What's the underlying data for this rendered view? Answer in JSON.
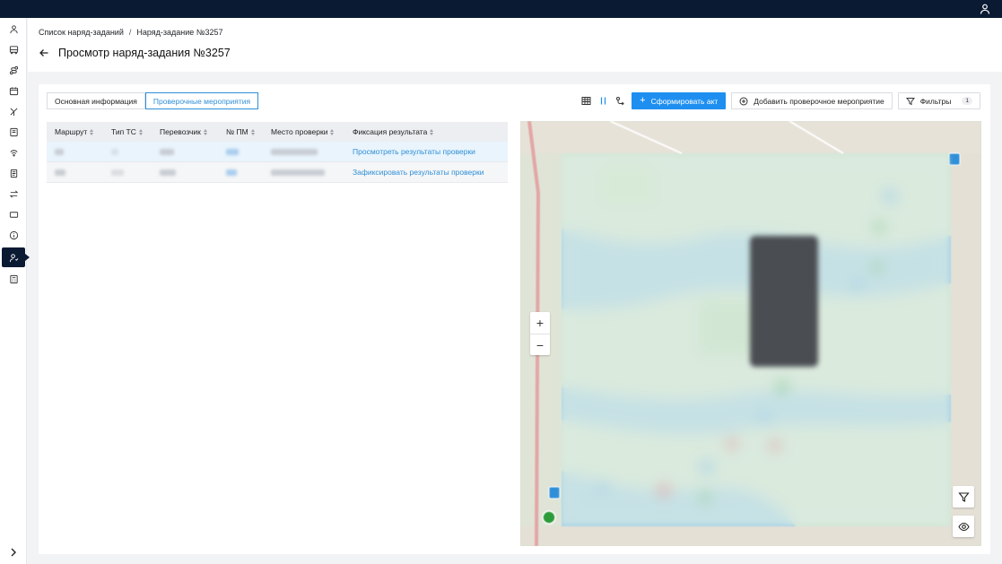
{
  "breadcrumbs": [
    "Список наряд-заданий",
    "Наряд-задание №3257"
  ],
  "breadcrumb_separator": "/",
  "page_title": "Просмотр наряд-задания №3257",
  "tabs": [
    {
      "label": "Основная информация",
      "active": false
    },
    {
      "label": "Проверочные мероприятия",
      "active": true
    }
  ],
  "toolbar": {
    "table_view_icon": "table-icon",
    "split_view_icon": "columns-icon",
    "map_view_icon": "map-route-icon",
    "primary_button": "Сформировать акт",
    "add_button": "Добавить проверочное мероприятие",
    "filters_button": "Фильтры",
    "filters_count": "1"
  },
  "table": {
    "columns": [
      "Маршрут",
      "Тип ТС",
      "Перевозчик",
      "№ ПМ",
      "Место проверки",
      "Фиксация результата"
    ],
    "rows": [
      {
        "result_action": "Просмотреть результаты проверки",
        "selected": true
      },
      {
        "result_action": "Зафиксировать результаты проверки",
        "selected": false
      }
    ]
  },
  "map": {
    "zoom_in": "+",
    "zoom_out": "−",
    "filter_icon": "filter-icon",
    "visibility_icon": "eye-icon"
  },
  "colors": {
    "topbar": "#0b1a33",
    "accent": "#1e8ff0",
    "link": "#2f8fd8"
  }
}
